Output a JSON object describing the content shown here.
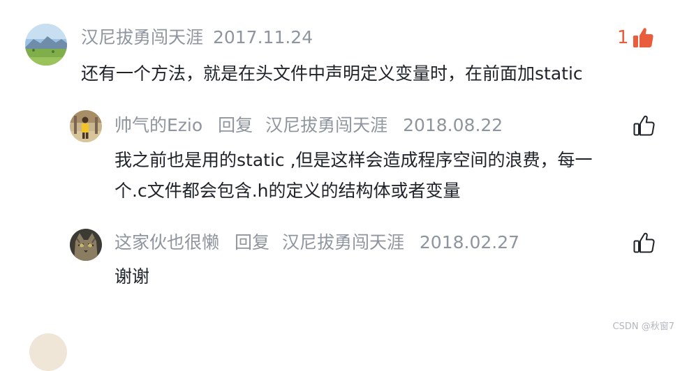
{
  "comments": [
    {
      "author": "汉尼拔勇闯天涯",
      "date": "2017.11.24",
      "text": "还有一个方法，就是在头文件中声明定义变量时，在前面加static",
      "like_count": "1",
      "avatar_icon": "landscape-avatar",
      "replies": [
        {
          "author": "帅气的Ezio",
          "reply_word": "回复",
          "reply_to": "汉尼拔勇闯天涯",
          "date": "2018.08.22",
          "text_lines": [
            "我之前也是用的static ,但是这样会造成程序空间的浪费，每一",
            "个.c文件都会包含.h的定义的结构体或者变量"
          ],
          "avatar_icon": "basketball-player-avatar"
        },
        {
          "author": "这家伙也很懒",
          "reply_word": "回复",
          "reply_to": "汉尼拔勇闯天涯",
          "date": "2018.02.27",
          "text_lines": [
            "谢谢"
          ],
          "avatar_icon": "cat-avatar"
        }
      ]
    }
  ],
  "watermark": "CSDN @秋窗7",
  "colors": {
    "meta_gray": "#8f959e",
    "text_dark": "#1f2329",
    "like_active": "#e95c3c"
  }
}
